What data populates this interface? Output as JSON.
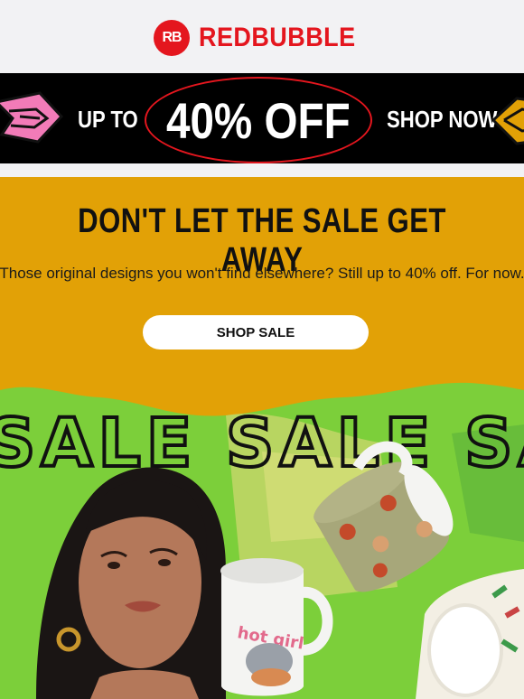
{
  "brand": {
    "logo_mark": "RB",
    "name": "REDBUBBLE",
    "color": "#e4161e"
  },
  "banner": {
    "up_to": "UP TO",
    "discount": "40% OFF",
    "shop_now": "SHOP NOW"
  },
  "promo": {
    "heading": "DON'T LET THE SALE GET AWAY",
    "body": "Those original designs you won't find elsewhere? Still up to 40% off. For now.",
    "button": "SHOP SALE",
    "background": "#e2a106"
  },
  "hero": {
    "sale_words": "SALE SALE SAL",
    "mug_text": "hot girl",
    "background": "#7ccf3a"
  }
}
